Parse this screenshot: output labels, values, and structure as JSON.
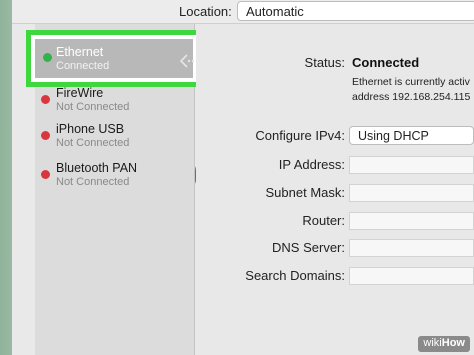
{
  "toolbar": {
    "location_label": "Location:",
    "location_value": "Automatic"
  },
  "services": [
    {
      "name": "Ethernet",
      "status": "Connected",
      "dot_color": "#32b34a",
      "icon": "ethernet-arrows-icon",
      "selected": true
    },
    {
      "name": "FireWire",
      "status": "Not Connected",
      "dot_color": "#d9363e",
      "icon": "firewire-icon"
    },
    {
      "name": "iPhone USB",
      "status": "Not Connected",
      "dot_color": "#d9363e",
      "icon": "iphone-icon"
    },
    {
      "name": "Bluetooth PAN",
      "status": "Not Connected",
      "dot_color": "#d9363e",
      "icon": "bluetooth-icon"
    }
  ],
  "detail": {
    "status_label": "Status:",
    "status_value": "Connected",
    "status_description_line1": "Ethernet is currently activ",
    "status_description_line2": "address 192.168.254.115",
    "configure_label": "Configure IPv4:",
    "configure_value": "Using DHCP",
    "ip_label": "IP Address:",
    "subnet_label": "Subnet Mask:",
    "router_label": "Router:",
    "dns_label": "DNS Server:",
    "search_label": "Search Domains:"
  },
  "watermark": {
    "prefix": "wiki",
    "suffix": "How"
  },
  "colors": {
    "highlight_border": "#3ed83e",
    "connected": "#32b34a",
    "disconnected": "#d9363e",
    "bluetooth": "#1e7fd8"
  }
}
